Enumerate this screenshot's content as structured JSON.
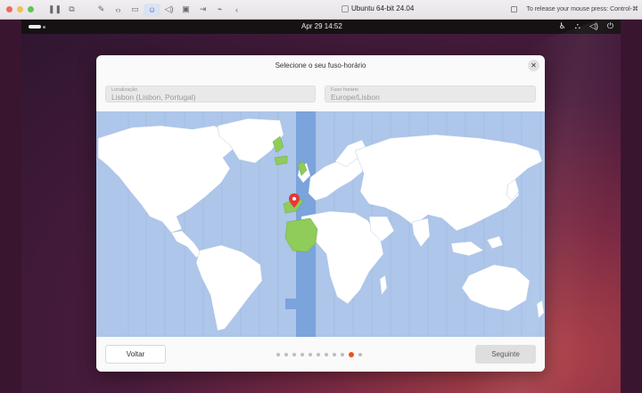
{
  "host": {
    "window_title": "Ubuntu 64-bit 24.04",
    "release_hint": "To release your mouse press: Control-⌘",
    "toolbar_icons": [
      "pause-icon",
      "snapshot-icon",
      "wrench-icon",
      "code-icon",
      "drive-icon",
      "user-icon",
      "volume-icon",
      "camera-icon",
      "share-icon",
      "usb-icon",
      "back-icon"
    ]
  },
  "gnome": {
    "clock": "Apr 29  14:52"
  },
  "dialog": {
    "title": "Selecione o seu fuso-horário",
    "location_label": "Localização",
    "location_value": "Lisbon (Lisbon, Portugal)",
    "timezone_label": "Fuso horário",
    "timezone_value": "Europe/Lisbon",
    "back_label": "Voltar",
    "next_label": "Seguinte",
    "steps_total": 11,
    "current_step": 10
  },
  "colors": {
    "ocean": "#adc6ea",
    "land": "#ffffff",
    "selected_zone": "#7ba3dc",
    "highlight_land": "#8fcc5a",
    "pin": "#e53935",
    "accent": "#e95420"
  }
}
